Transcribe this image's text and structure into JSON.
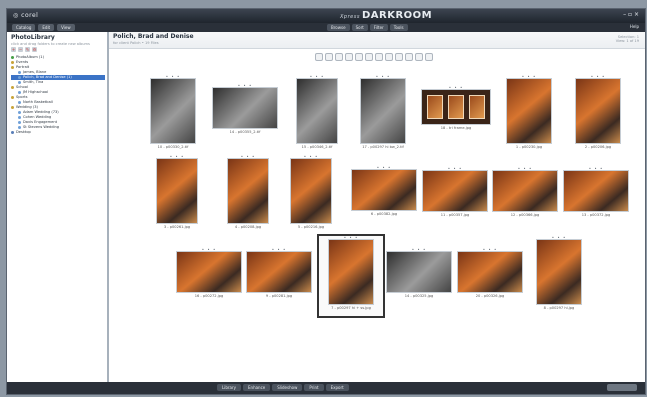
{
  "window": {
    "app_logo": "◎ corel",
    "brand_prefix": "Xpress",
    "brand": "DARKROOM",
    "controls": "– ▫ ×"
  },
  "menubar": {
    "left_buttons": [
      "Catalog",
      "Edit",
      "View"
    ],
    "center_tabs": [
      "Browse",
      "Sort",
      "Filter",
      "Tools"
    ],
    "right_text": "Help"
  },
  "sidebar": {
    "title": "PhotoLibrary",
    "subtitle": "click and drag folders to create new albums",
    "tree": [
      {
        "label": "PhotoAlbum (1)",
        "color": "#46a046",
        "indent": 0,
        "selected": false
      },
      {
        "label": "Events",
        "color": "#c9a43a",
        "indent": 0,
        "selected": false
      },
      {
        "label": "Portrait",
        "color": "#c9a43a",
        "indent": 0,
        "selected": false
      },
      {
        "label": "James, Blane",
        "color": "#6fa0d8",
        "indent": 1,
        "selected": false
      },
      {
        "label": "Polich, Brad and Denise (1)",
        "color": "#6fa0d8",
        "indent": 1,
        "selected": true
      },
      {
        "label": "Smith, Tina",
        "color": "#6fa0d8",
        "indent": 1,
        "selected": false
      },
      {
        "label": "School",
        "color": "#c9a43a",
        "indent": 0,
        "selected": false
      },
      {
        "label": "JM Highschool",
        "color": "#6fa0d8",
        "indent": 1,
        "selected": false
      },
      {
        "label": "Sports",
        "color": "#c9a43a",
        "indent": 0,
        "selected": false
      },
      {
        "label": "North Basketball",
        "color": "#6fa0d8",
        "indent": 1,
        "selected": false
      },
      {
        "label": "Wedding (3)",
        "color": "#c9a43a",
        "indent": 0,
        "selected": false
      },
      {
        "label": "Adam Wedding (73)",
        "color": "#6fa0d8",
        "indent": 1,
        "selected": false
      },
      {
        "label": "Cohen Wedding",
        "color": "#6fa0d8",
        "indent": 1,
        "selected": false
      },
      {
        "label": "Davis Engagement",
        "color": "#6fa0d8",
        "indent": 1,
        "selected": false
      },
      {
        "label": "St Stevens Wedding",
        "color": "#6fa0d8",
        "indent": 1,
        "selected": false
      },
      {
        "label": "Desktop",
        "color": "#5a7fb8",
        "indent": 0,
        "selected": false
      }
    ]
  },
  "main": {
    "title": "Polich, Brad and Denise",
    "subtitle": "for client Polich • 19 Files",
    "right_lines": [
      "Selection: 1",
      "View: 1 of 19"
    ]
  },
  "photos": [
    {
      "file": "10 - p00330_2.tif",
      "tone": "bw",
      "dots": "• • •"
    },
    {
      "file": "14 - p00355_2.tif",
      "tone": "bw",
      "dots": "• • •"
    },
    {
      "file": "15 - p00346_2.tif",
      "tone": "bw",
      "dots": "• • •"
    },
    {
      "file": "17 - p00297 hi bw_2.tif",
      "tone": "bw",
      "dots": "• • •"
    },
    {
      "file": "18 - tri frame.jpg",
      "tone": "frame",
      "dots": "• • •"
    },
    {
      "file": "1 - p00230.jpg",
      "tone": "color",
      "dots": "• • •"
    },
    {
      "file": "2 - p00206.jpg",
      "tone": "color",
      "dots": "• • •"
    },
    {
      "file": "3 - p00261.jpg",
      "tone": "color",
      "dots": "• • •"
    },
    {
      "file": "4 - p00208.jpg",
      "tone": "color",
      "dots": "• • •"
    },
    {
      "file": "5 - p00216.jpg",
      "tone": "color",
      "dots": "• • •"
    },
    {
      "file": "6 - p00382.jpg",
      "tone": "color",
      "dots": "• • •"
    },
    {
      "file": "11 - p00357.jpg",
      "tone": "color",
      "dots": "• • •"
    },
    {
      "file": "12 - p00366.jpg",
      "tone": "color",
      "dots": "• • •"
    },
    {
      "file": "13 - p00372.jpg",
      "tone": "color",
      "dots": "• • •"
    },
    {
      "file": "16 - p00272.jpg",
      "tone": "color",
      "dots": "• • •"
    },
    {
      "file": "9 - p00281.jpg",
      "tone": "color",
      "dots": "• • •"
    },
    {
      "file": "7 - p00297 hi + ss.jpg",
      "tone": "color",
      "dots": "• • •"
    },
    {
      "file": "14 - p00325.jpg",
      "tone": "bw",
      "dots": "• • •"
    },
    {
      "file": "20 - p00326.jpg",
      "tone": "color",
      "dots": "• • •"
    },
    {
      "file": "8 - p00297 hi.jpg",
      "tone": "color",
      "dots": "• • •"
    }
  ],
  "bottombar": {
    "tabs": [
      "Library",
      "Enhance",
      "Slideshow",
      "Print",
      "Export"
    ]
  },
  "colors": {
    "accent": "#3b73c6",
    "chrome_dark": "#2a3039",
    "sidebar_bg": "#ffffff"
  }
}
